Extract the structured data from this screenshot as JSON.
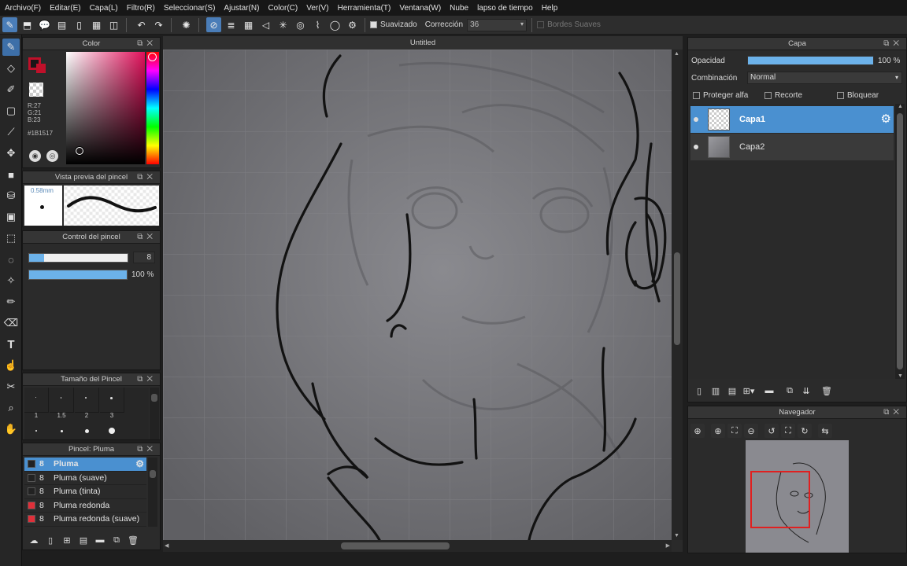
{
  "menu": [
    "Archivo(F)",
    "Editar(E)",
    "Capa(L)",
    "Filtro(R)",
    "Seleccionar(S)",
    "Ajustar(N)",
    "Color(C)",
    "Ver(V)",
    "Herramienta(T)",
    "Ventana(W)",
    "Nube",
    "lapso de tiempo",
    "Help"
  ],
  "toolbar": {
    "smoothing_label": "Suavizado",
    "correction_label": "Corrección",
    "correction_value": "36",
    "soft_edges_label": "Bordes Suaves"
  },
  "color_panel": {
    "title": "Color",
    "r": "R:27",
    "g": "G:21",
    "b": "B:23",
    "hex": "#1B1517",
    "current_color": "#1b1517"
  },
  "brush_preview": {
    "title": "Vista previa del pincel",
    "size": "0.58mm"
  },
  "brush_control": {
    "title": "Control del pincel",
    "size_value": "8",
    "opacity_value": "100 %",
    "size_fraction": 0.1,
    "opacity_fraction": 1.0
  },
  "brush_size": {
    "title": "Tamaño del Pincel",
    "sizes": [
      "1",
      "1.5",
      "2",
      "3"
    ]
  },
  "brush_list": {
    "title": "Pincel: Pluma",
    "items": [
      {
        "size": "8",
        "name": "Pluma",
        "color": "#222222",
        "selected": true
      },
      {
        "size": "8",
        "name": "Pluma (suave)",
        "color": "#222222",
        "selected": false
      },
      {
        "size": "8",
        "name": "Pluma (tinta)",
        "color": "#222222",
        "selected": false
      },
      {
        "size": "8",
        "name": "Pluma redonda",
        "color": "#e0303a",
        "selected": false
      },
      {
        "size": "8",
        "name": "Pluma redonda (suave)",
        "color": "#e0303a",
        "selected": false
      }
    ]
  },
  "canvas": {
    "title": "Untitled"
  },
  "layer_panel": {
    "title": "Capa",
    "opacity_label": "Opacidad",
    "opacity_value": "100 %",
    "opacity_fraction": 1.0,
    "blend_label": "Combinación",
    "blend_value": "Normal",
    "protect_alpha": "Proteger alfa",
    "clip": "Recorte",
    "lock": "Bloquear",
    "layers": [
      {
        "name": "Capa1",
        "selected": true
      },
      {
        "name": "Capa2",
        "selected": false
      }
    ]
  },
  "navigator": {
    "title": "Navegador"
  },
  "colors": {
    "accent": "#5aa9e6",
    "selection": "#4a90d0",
    "panel": "#2b2b2b",
    "nav_frame": "#e02020"
  }
}
